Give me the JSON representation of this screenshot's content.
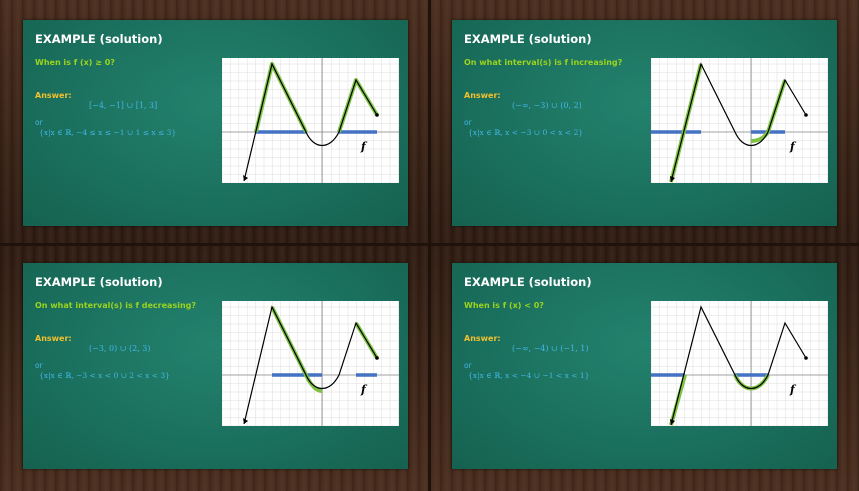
{
  "colors": {
    "board": "#1b7462",
    "title": "#ffffff",
    "question": "#9bd41e",
    "answer_label": "#f2c12e",
    "answer_value": "#42b8e6",
    "highlight_curve": "#7dc242",
    "highlight_axis": "#4472c4",
    "curve": "#000000"
  },
  "slides": [
    {
      "title": "EXAMPLE (solution)",
      "question": "When is f (x) ≥ 0?",
      "answer_label": "Answer:",
      "answer_interval": "[−4, −1] ∪ [1, 3]",
      "or_label": "or",
      "answer_set": "{x|x ∈ ℝ, −4 ≤ x ≤ −1  ∪  1 ≤ x ≤ 3}",
      "function_label": "f"
    },
    {
      "title": "EXAMPLE (solution)",
      "question": "On what interval(s) is f increasing?",
      "answer_label": "Answer:",
      "answer_interval": "(−∞, −3) ∪ (0, 2)",
      "or_label": "or",
      "answer_set": "{x|x ∈ ℝ, x < −3  ∪  0 < x < 2}",
      "function_label": "f"
    },
    {
      "title": "EXAMPLE (solution)",
      "question": "On what interval(s) is f decreasing?",
      "answer_label": "Answer:",
      "answer_interval": "(−3, 0) ∪ (2, 3)",
      "or_label": "or",
      "answer_set": "{x|x ∈ ℝ, −3 < x < 0  ∪  2 < x < 3}",
      "function_label": "f"
    },
    {
      "title": "EXAMPLE (solution)",
      "question": "When is f (x) < 0?",
      "answer_label": "Answer:",
      "answer_interval": "(−∞, −4) ∪ (−1, 1)",
      "or_label": "or",
      "answer_set": "{x|x ∈ ℝ, x < −4  ∪  −1 < x < 1}",
      "function_label": "f"
    }
  ]
}
